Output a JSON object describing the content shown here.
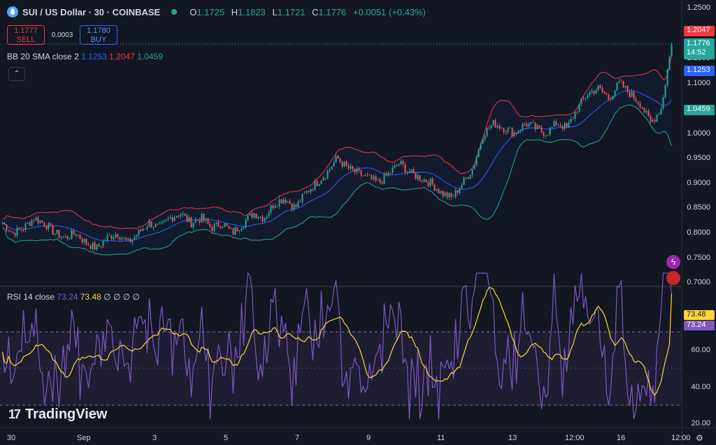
{
  "header": {
    "symbol": "SUI / US Dollar · 30 · COINBASE",
    "open_label": "O",
    "open": "1.1725",
    "high_label": "H",
    "high": "1.1823",
    "low_label": "L",
    "low": "1.1721",
    "close_label": "C",
    "close": "1.1776",
    "change": "+0.0051 (+0.43%)"
  },
  "trade": {
    "sell_price": "1.1777",
    "sell_label": "SELL",
    "spread": "0.0003",
    "buy_price": "1.1780",
    "buy_label": "BUY"
  },
  "bb_legend": {
    "name": "BB",
    "params": "20 SMA close 2",
    "basis": "1.1253",
    "upper": "1.2047",
    "lower": "1.0459"
  },
  "rsi_legend": {
    "name": "RSI",
    "params": "14 close",
    "rsi": "73.24",
    "ma": "73.48",
    "extra": "∅ ∅ ∅ ∅"
  },
  "price_axis": [
    "1.2500",
    "1.1500",
    "1.1000",
    "1.0500",
    "1.0000",
    "0.9500",
    "0.9000",
    "0.8500",
    "0.8000",
    "0.7500",
    "0.7000"
  ],
  "price_tags": {
    "upper": "1.2047",
    "last": "1.1776",
    "countdown": "14:52",
    "basis": "1.1253",
    "lower": "1.0459"
  },
  "rsi_axis": [
    "60.00",
    "40.00",
    "20.00"
  ],
  "rsi_tags": {
    "ma": "73.48",
    "rsi": "73.24"
  },
  "time_axis": [
    "30",
    "Sep",
    "3",
    "5",
    "7",
    "9",
    "11",
    "13",
    "12:00",
    "16",
    "12:00"
  ],
  "brand": "TradingView",
  "colors": {
    "bg": "#131722",
    "up": "#26a69a",
    "down": "#ef5350",
    "basis": "#2962ff",
    "upper": "#f23645",
    "lower": "#26a69a",
    "rsi": "#7e57c2",
    "rsi_ma": "#fdd835"
  },
  "chart_data": {
    "type": "line",
    "series": [
      {
        "name": "SUI / US Dollar",
        "values": [
          0.82,
          0.8,
          0.81,
          0.83,
          0.82,
          0.8,
          0.79,
          0.8,
          0.78,
          0.77,
          0.79,
          0.8,
          0.78,
          0.8,
          0.82,
          0.81,
          0.83,
          0.84,
          0.82,
          0.83,
          0.81,
          0.82,
          0.8,
          0.82,
          0.84,
          0.83,
          0.86,
          0.87,
          0.85,
          0.88,
          0.9,
          0.92,
          0.95,
          0.93,
          0.92,
          0.91,
          0.9,
          0.92,
          0.94,
          0.92,
          0.91,
          0.9,
          0.88,
          0.87,
          0.9,
          0.93,
          1.0,
          1.02,
          1.01,
          1.0,
          1.02,
          1.01,
          1.0,
          1.02,
          1.01,
          1.05,
          1.08,
          1.09,
          1.07,
          1.1,
          1.08,
          1.06,
          1.02,
          1.05,
          1.1776
        ]
      },
      {
        "name": "BB upper",
        "values": []
      },
      {
        "name": "BB basis",
        "values": []
      },
      {
        "name": "BB lower",
        "values": []
      },
      {
        "name": "RSI",
        "values": []
      }
    ],
    "ylim": [
      0.7,
      1.25
    ],
    "rsi_ylim": [
      20,
      80
    ],
    "x_ticks": [
      "30",
      "Sep",
      "3",
      "5",
      "7",
      "9",
      "11",
      "13",
      "12:00",
      "16",
      "12:00"
    ]
  }
}
